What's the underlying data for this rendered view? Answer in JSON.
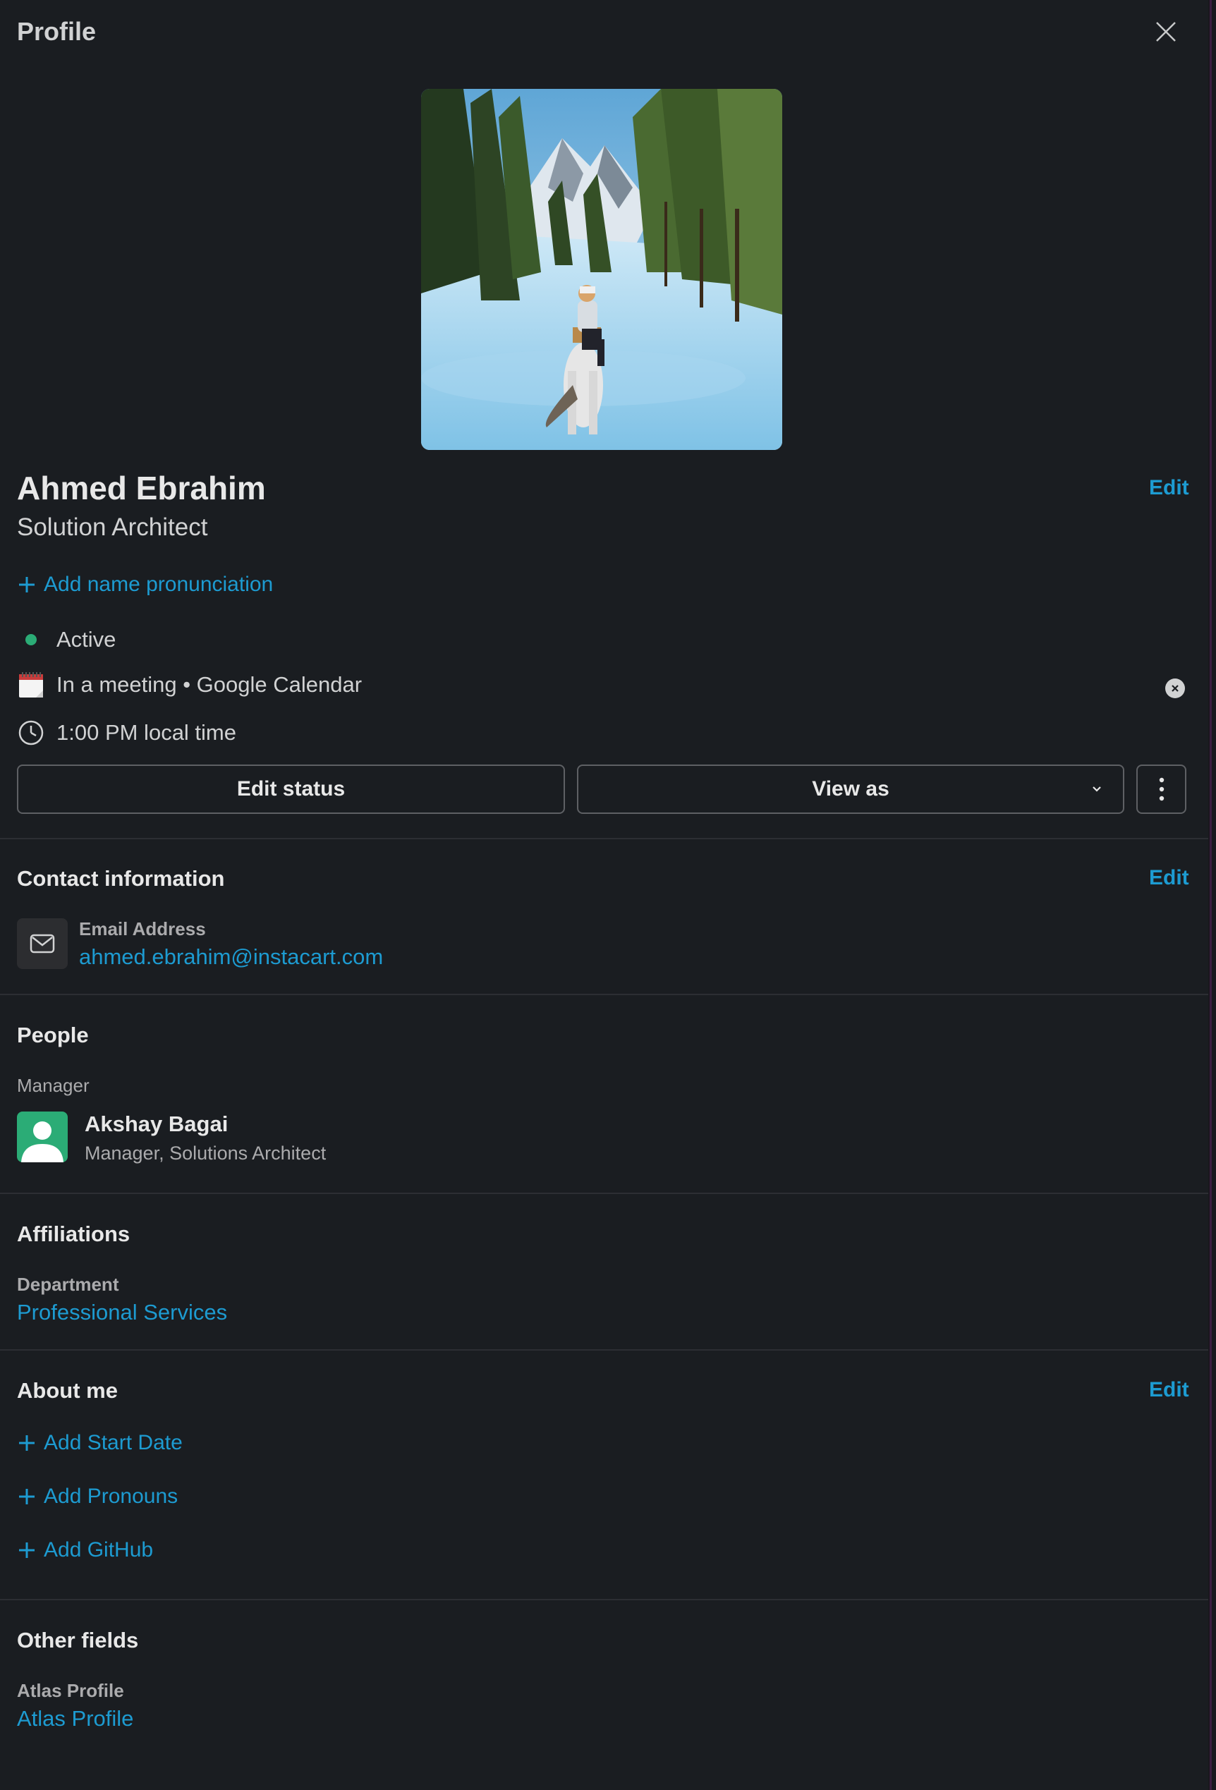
{
  "header": {
    "title": "Profile"
  },
  "profile": {
    "name": "Ahmed Ebrahim",
    "job_title": "Solution Architect",
    "edit_label": "Edit",
    "add_pronunciation": "Add name pronunciation",
    "presence": "Active",
    "status_text": "In a meeting • Google Calendar",
    "local_time": "1:00 PM local time"
  },
  "actions": {
    "edit_status": "Edit status",
    "view_as": "View as"
  },
  "contact": {
    "title": "Contact information",
    "edit_label": "Edit",
    "email_label": "Email Address",
    "email_value": "ahmed.ebrahim@instacart.com"
  },
  "people": {
    "title": "People",
    "manager_label": "Manager",
    "manager_name": "Akshay Bagai",
    "manager_title": "Manager, Solutions Architect"
  },
  "affiliations": {
    "title": "Affiliations",
    "department_label": "Department",
    "department_value": "Professional Services"
  },
  "about": {
    "title": "About me",
    "edit_label": "Edit",
    "add_start_date": "Add Start Date",
    "add_pronouns": "Add Pronouns",
    "add_github": "Add GitHub"
  },
  "other": {
    "title": "Other fields",
    "atlas_label": "Atlas Profile",
    "atlas_value": "Atlas Profile"
  },
  "colors": {
    "background": "#1a1d21",
    "link": "#1d9bd1",
    "presence_active": "#2bac76",
    "divider": "#2c2e33"
  },
  "icons": [
    "close-icon",
    "plus-icon",
    "calendar-emoji-icon",
    "clock-icon",
    "chevron-down-icon",
    "more-vertical-icon",
    "envelope-icon",
    "clear-status-icon",
    "user-avatar-icon"
  ]
}
